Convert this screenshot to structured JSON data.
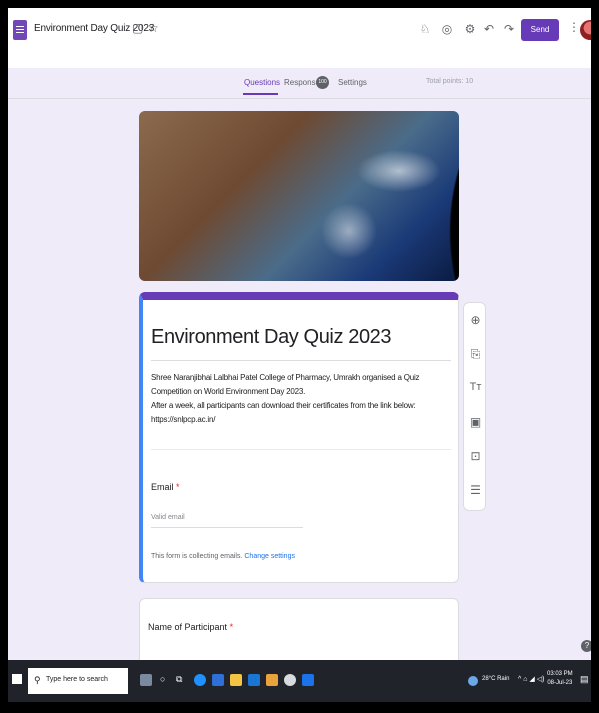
{
  "header": {
    "title": "Environment Day Quiz 2023",
    "folder_icon": "folder-icon",
    "star_icon": "star-icon",
    "send_label": "Send",
    "icons": [
      "palette-icon",
      "preview-eye-icon",
      "settings-icon",
      "undo-icon",
      "redo-icon"
    ]
  },
  "tabs": {
    "questions": "Questions",
    "responses": "Responses",
    "responses_count": "100",
    "settings": "Settings",
    "total_points": "Total points: 10"
  },
  "form": {
    "title": "Environment Day Quiz 2023",
    "description_1": "Shree Naranjibhai Lalbhai Patel College of Pharmacy, Umrakh organised  a Quiz Competition on World Environment Day 2023.",
    "description_2": "After a week, all participants can download their certificates from the link below:",
    "description_3": "https://snlpcp.ac.in/",
    "email_label": "Email",
    "required_mark": "*",
    "email_placeholder": "Valid email",
    "collecting_text": "This form is collecting emails.",
    "change_settings": "Change settings",
    "q1_label": "Name of Participant"
  },
  "side_toolbar": [
    "add-question-icon",
    "import-questions-icon",
    "add-title-icon",
    "add-image-icon",
    "add-video-icon",
    "add-section-icon"
  ],
  "taskbar": {
    "search_placeholder": "Type here to search",
    "weather": "28°C Rain",
    "time": "03:03 PM",
    "date": "08-Jul-23"
  }
}
